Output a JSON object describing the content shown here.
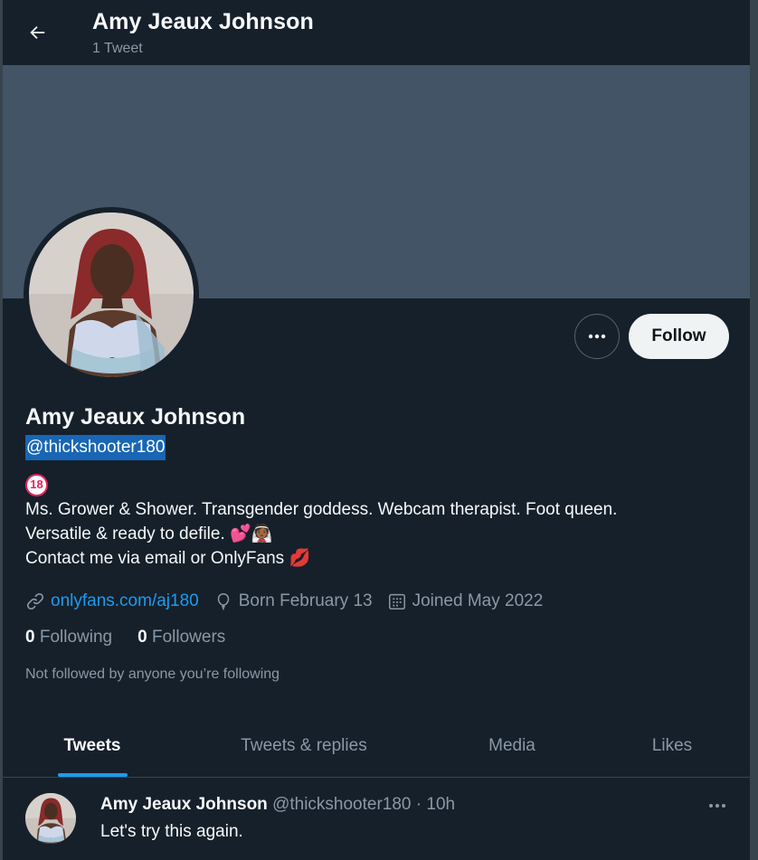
{
  "header": {
    "name": "Amy Jeaux Johnson",
    "tweet_count": "1 Tweet"
  },
  "profile": {
    "name": "Amy Jeaux Johnson",
    "handle": "@thickshooter180",
    "follow_label": "Follow",
    "bio_badge": "18",
    "bio_line1": "Ms. Grower & Shower. Transgender goddess. Webcam therapist. Foot queen.",
    "bio_line2": "Versatile & ready to defile.",
    "bio_line2_emoji": "💕👰🏾",
    "bio_line3": "Contact me via email or OnlyFans",
    "bio_line3_emoji": "💋",
    "website": "onlyfans.com/aj180",
    "birthday": "Born February 13",
    "joined": "Joined May 2022",
    "following_count": "0",
    "following_label": "Following",
    "followers_count": "0",
    "followers_label": "Followers",
    "not_followed": "Not followed by anyone you’re following"
  },
  "tabs": [
    {
      "label": "Tweets",
      "active": true
    },
    {
      "label": "Tweets & replies",
      "active": false
    },
    {
      "label": "Media",
      "active": false
    },
    {
      "label": "Likes",
      "active": false
    }
  ],
  "tweet": {
    "name": "Amy Jeaux Johnson",
    "handle_time": "@thickshooter180 · 10h",
    "text": "Let's try this again."
  },
  "colors": {
    "background": "#15202b",
    "banner": "#425466",
    "accent": "#1d9bf0",
    "secondary_text": "#8b98a5"
  },
  "icons": [
    "back-arrow-icon",
    "more-icon",
    "link-icon",
    "balloon-icon",
    "calendar-icon"
  ]
}
